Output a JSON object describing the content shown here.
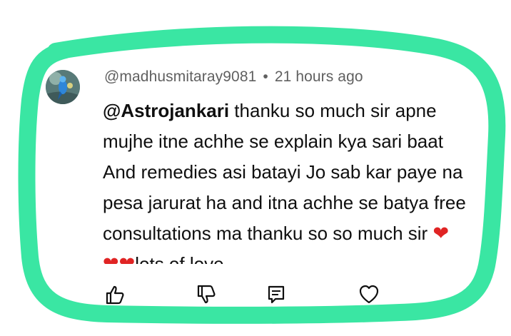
{
  "comment": {
    "author": "@madhusmitaray9081",
    "separator": "•",
    "timestamp": "21 hours ago",
    "mention": "@Astrojankari",
    "lines": [
      " thanku so much sir apne",
      "mujhe itne achhe se explain kya sari baat",
      "And remedies asi batayi Jo sab kar paye na",
      "pesa jarurat ha and itna achhe se batya free",
      "consultations ma thanku so so much sir "
    ],
    "last_line_text": "lots of love",
    "heart": "❤"
  },
  "colors": {
    "highlight_stroke": "#3ae6a3",
    "heart": "#e02424",
    "meta_text": "#606060",
    "body_text": "#0f0f0f"
  },
  "icons": [
    "like-icon",
    "dislike-icon",
    "reply-icon",
    "heart-react-icon"
  ]
}
